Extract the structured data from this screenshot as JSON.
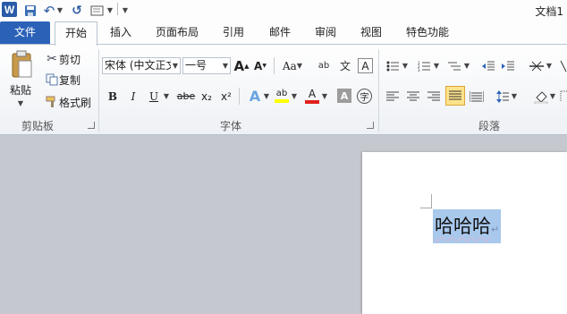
{
  "titlebar": {
    "logo": "W",
    "undo": "↶",
    "redo": "↺",
    "title": "文档1"
  },
  "tabs": {
    "file": "文件",
    "home": "开始",
    "insert": "插入",
    "layout": "页面布局",
    "references": "引用",
    "mailings": "邮件",
    "review": "审阅",
    "view": "视图",
    "special": "特色功能"
  },
  "clipboard": {
    "paste": "粘贴",
    "cut": "剪切",
    "copy": "复制",
    "format_painter": "格式刷",
    "label": "剪贴板"
  },
  "font": {
    "name": "宋体 (中文正文)",
    "size": "一号",
    "grow": "A",
    "shrink": "A",
    "change_case": "Aa",
    "clear": "ab",
    "phonetic": "文",
    "border_char": "A",
    "bold": "B",
    "italic": "I",
    "underline": "U",
    "strike": "abe",
    "subscript": "x₂",
    "superscript": "x²",
    "effects": "A",
    "highlight": "ab",
    "color": "A",
    "shading": "A",
    "enclose": "字",
    "label": "字体"
  },
  "paragraph": {
    "label": "段落"
  },
  "document": {
    "text": "哈哈哈",
    "para_mark": "↵"
  },
  "colors": {
    "accent": "#2b62b8",
    "selection": "#a8c8ec",
    "highlight_yellow": "#ffff00",
    "font_red": "#e0201c"
  }
}
